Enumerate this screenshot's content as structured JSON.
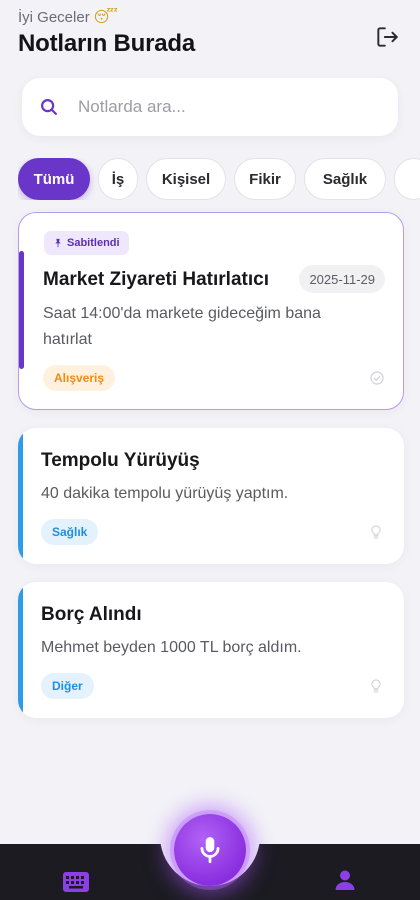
{
  "header": {
    "greeting": "İyi Geceler",
    "greeting_emoji": "😴",
    "title": "Notların Burada",
    "logout_icon": "logout-icon"
  },
  "search": {
    "placeholder": "Notlarda ara..."
  },
  "filters": [
    {
      "label": "Tümü",
      "active": true
    },
    {
      "label": "İş",
      "active": false
    },
    {
      "label": "Kişisel",
      "active": false
    },
    {
      "label": "Fikir",
      "active": false
    },
    {
      "label": "Sağlık",
      "active": false
    }
  ],
  "notes": [
    {
      "pinned_label": "Sabitlendi",
      "title": "Market Ziyareti Hatırlatıcı",
      "date": "2025-11-29",
      "body": "Saat 14:00'da markete gideceğim bana hatırlat",
      "tag": "Alışveriş",
      "tag_color": "#f5890b",
      "accent": "#6a35c9"
    },
    {
      "title": "Tempolu Yürüyüş",
      "body": "40 dakika tempolu yürüyüş yaptım.",
      "tag": "Sağlık",
      "tag_color": "#1f8fe0",
      "accent": "#2e9be8"
    },
    {
      "title": "Borç Alındı",
      "body": "Mehmet beyden 1000 TL borç aldım.",
      "tag": "Diğer",
      "tag_color": "#1f8fe0",
      "accent": "#2e9be8"
    }
  ],
  "colors": {
    "primary": "#6a35c9",
    "background": "#f3f3f7",
    "navbar": "#1b1b21",
    "mic": "#9b45ea"
  },
  "navbar": {
    "left_icon": "keyboard-icon",
    "center_icon": "microphone-icon",
    "right_icon": "profile-icon"
  }
}
